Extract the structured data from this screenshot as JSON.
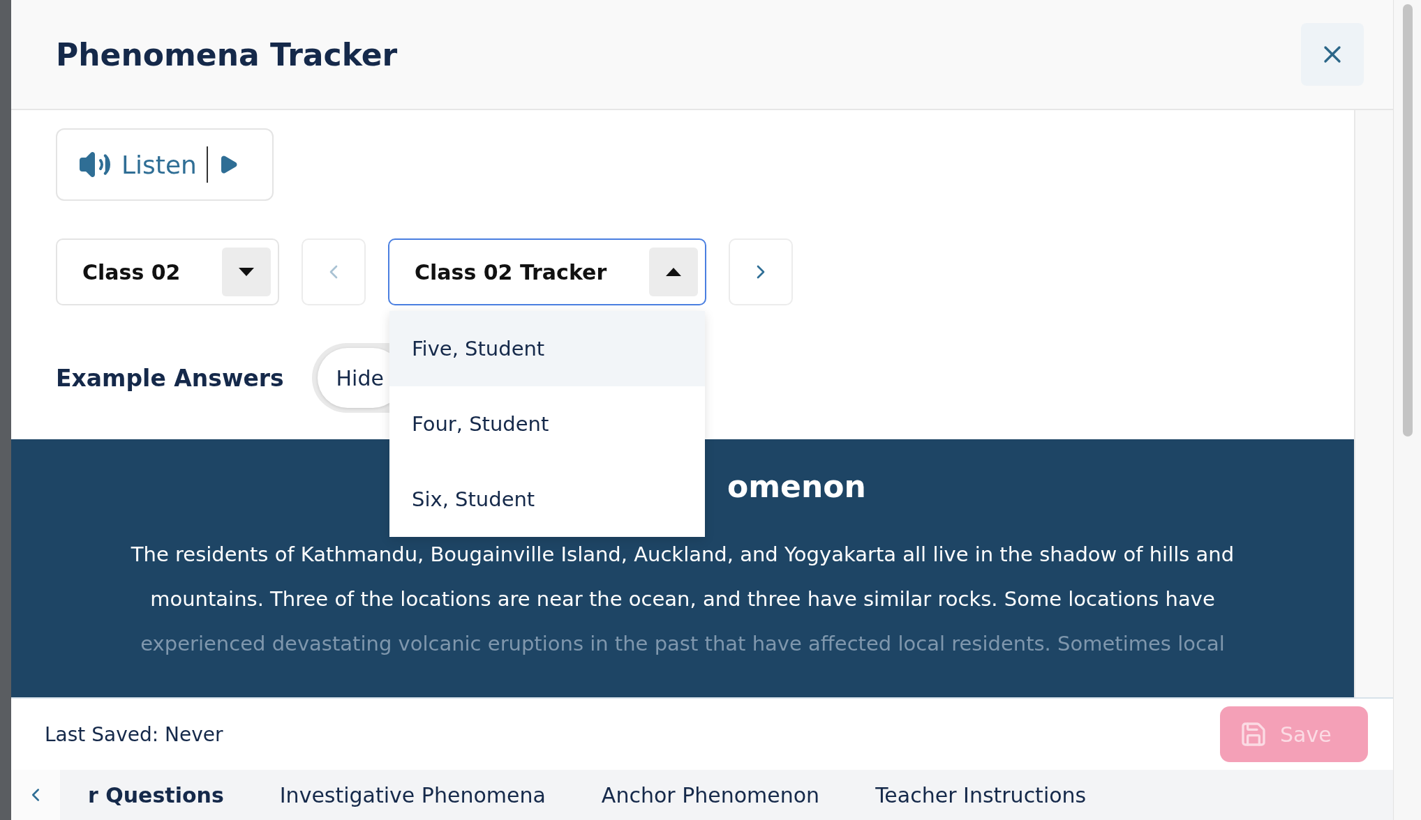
{
  "modal": {
    "title": "Phenomena Tracker"
  },
  "listen": {
    "label": "Listen"
  },
  "class_select": {
    "value": "Class 02"
  },
  "tracker_select": {
    "value": "Class 02 Tracker",
    "expanded": true,
    "options": [
      {
        "label": "Five, Student",
        "selected": true
      },
      {
        "label": "Four, Student",
        "selected": false
      },
      {
        "label": "Six, Student",
        "selected": false
      }
    ]
  },
  "example_answers": {
    "label": "Example Answers",
    "toggle": "Hide",
    "on": true
  },
  "phenomenon": {
    "heading": "omenon",
    "lines": [
      "The residents of Kathmandu, Bougainville Island, Auckland, and Yogyakarta all live in the shadow of hills and",
      "mountains. Three of the locations are near the ocean, and three have similar rocks. Some locations have",
      "experienced devastating volcanic eruptions in the past that have affected local residents. Sometimes local"
    ]
  },
  "footer": {
    "last_saved": "Last Saved: Never",
    "save": "Save"
  },
  "tabs": [
    {
      "label": "r Questions",
      "selected": true
    },
    {
      "label": "Investigative Phenomena",
      "selected": false
    },
    {
      "label": "Anchor Phenomenon",
      "selected": false
    },
    {
      "label": "Teacher Instructions",
      "selected": false
    }
  ]
}
